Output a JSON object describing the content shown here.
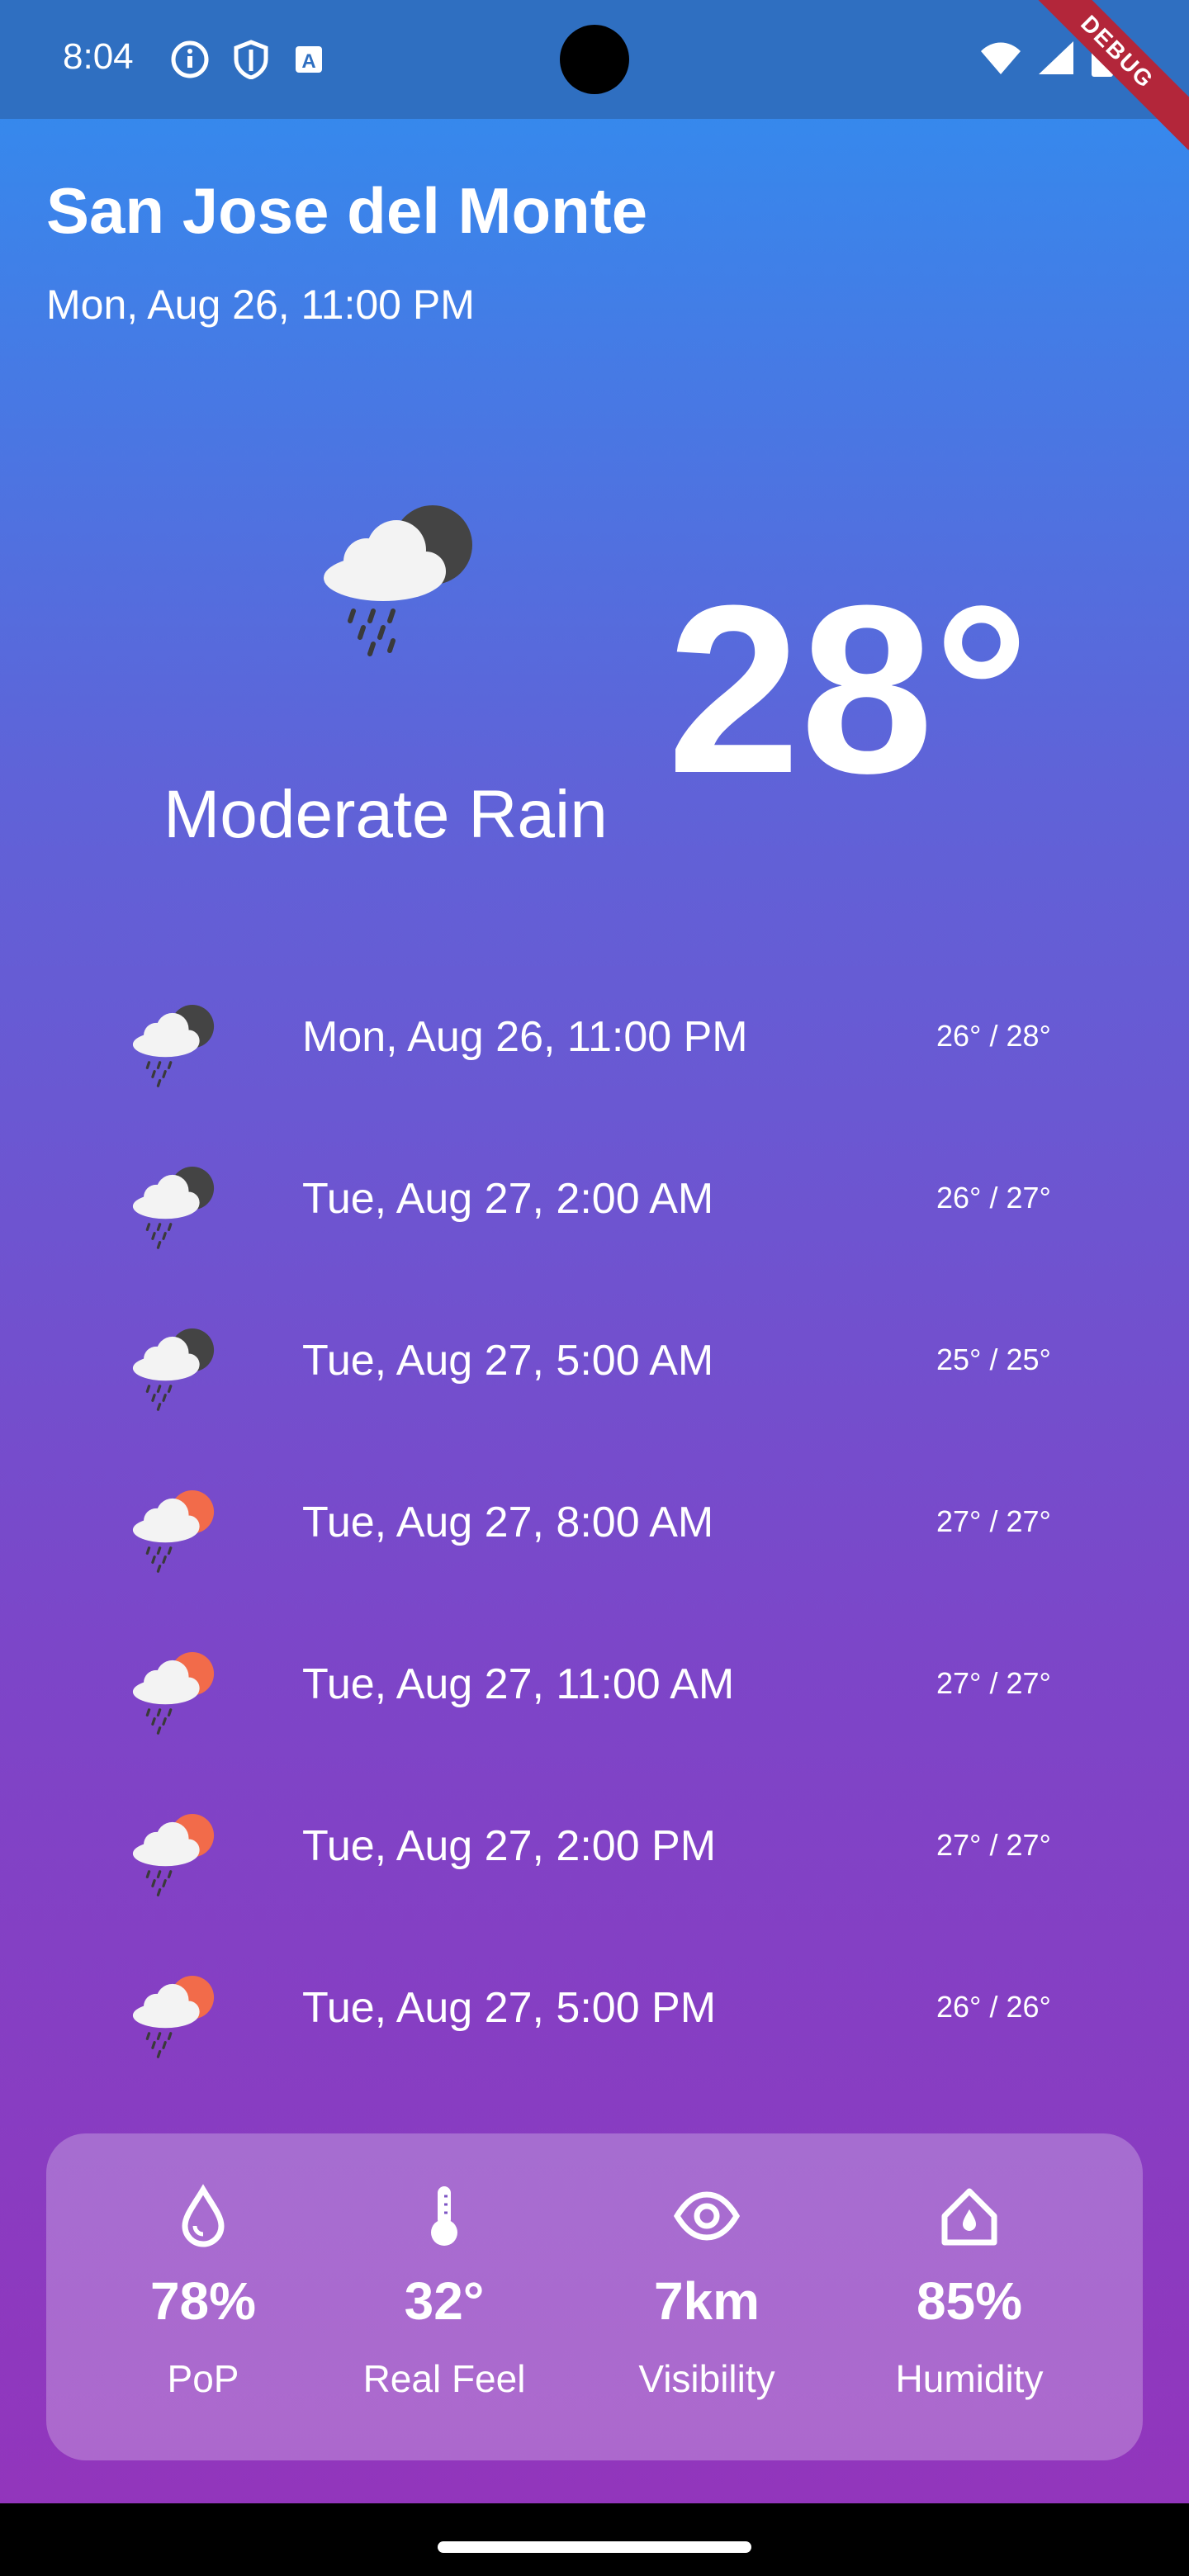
{
  "status_bar": {
    "time": "8:04",
    "debug": "DEBUG"
  },
  "location": {
    "city": "San Jose del Monte",
    "datetime": "Mon, Aug 26, 11:00 PM"
  },
  "current": {
    "condition": "Moderate Rain",
    "temp": "28°",
    "icon": "rain-night-icon"
  },
  "forecast": [
    {
      "time": "Mon, Aug 26, 11:00 PM",
      "temp": "26° / 28°",
      "icon": "rain-night-icon"
    },
    {
      "time": "Tue, Aug 27, 2:00 AM",
      "temp": "26° / 27°",
      "icon": "rain-night-icon"
    },
    {
      "time": "Tue, Aug 27, 5:00 AM",
      "temp": "25° / 25°",
      "icon": "rain-night-icon"
    },
    {
      "time": "Tue, Aug 27, 8:00 AM",
      "temp": "27° / 27°",
      "icon": "rain-day-icon"
    },
    {
      "time": "Tue, Aug 27, 11:00 AM",
      "temp": "27° / 27°",
      "icon": "rain-day-icon"
    },
    {
      "time": "Tue, Aug 27, 2:00 PM",
      "temp": "27° / 27°",
      "icon": "rain-day-icon"
    },
    {
      "time": "Tue, Aug 27, 5:00 PM",
      "temp": "26° / 26°",
      "icon": "rain-day-icon"
    }
  ],
  "details": [
    {
      "value": "78%",
      "label": "PoP",
      "icon": "droplet-icon"
    },
    {
      "value": "32°",
      "label": "Real Feel",
      "icon": "thermometer-icon"
    },
    {
      "value": "7km",
      "label": "Visibility",
      "icon": "eye-icon"
    },
    {
      "value": "85%",
      "label": "Humidity",
      "icon": "home-icon"
    }
  ],
  "colors": {
    "gradient_top": "#2f8ff0",
    "gradient_bottom": "#9434bb",
    "moon": "#444444",
    "sun": "#f26b4a",
    "cloud": "#f3f3f3"
  }
}
